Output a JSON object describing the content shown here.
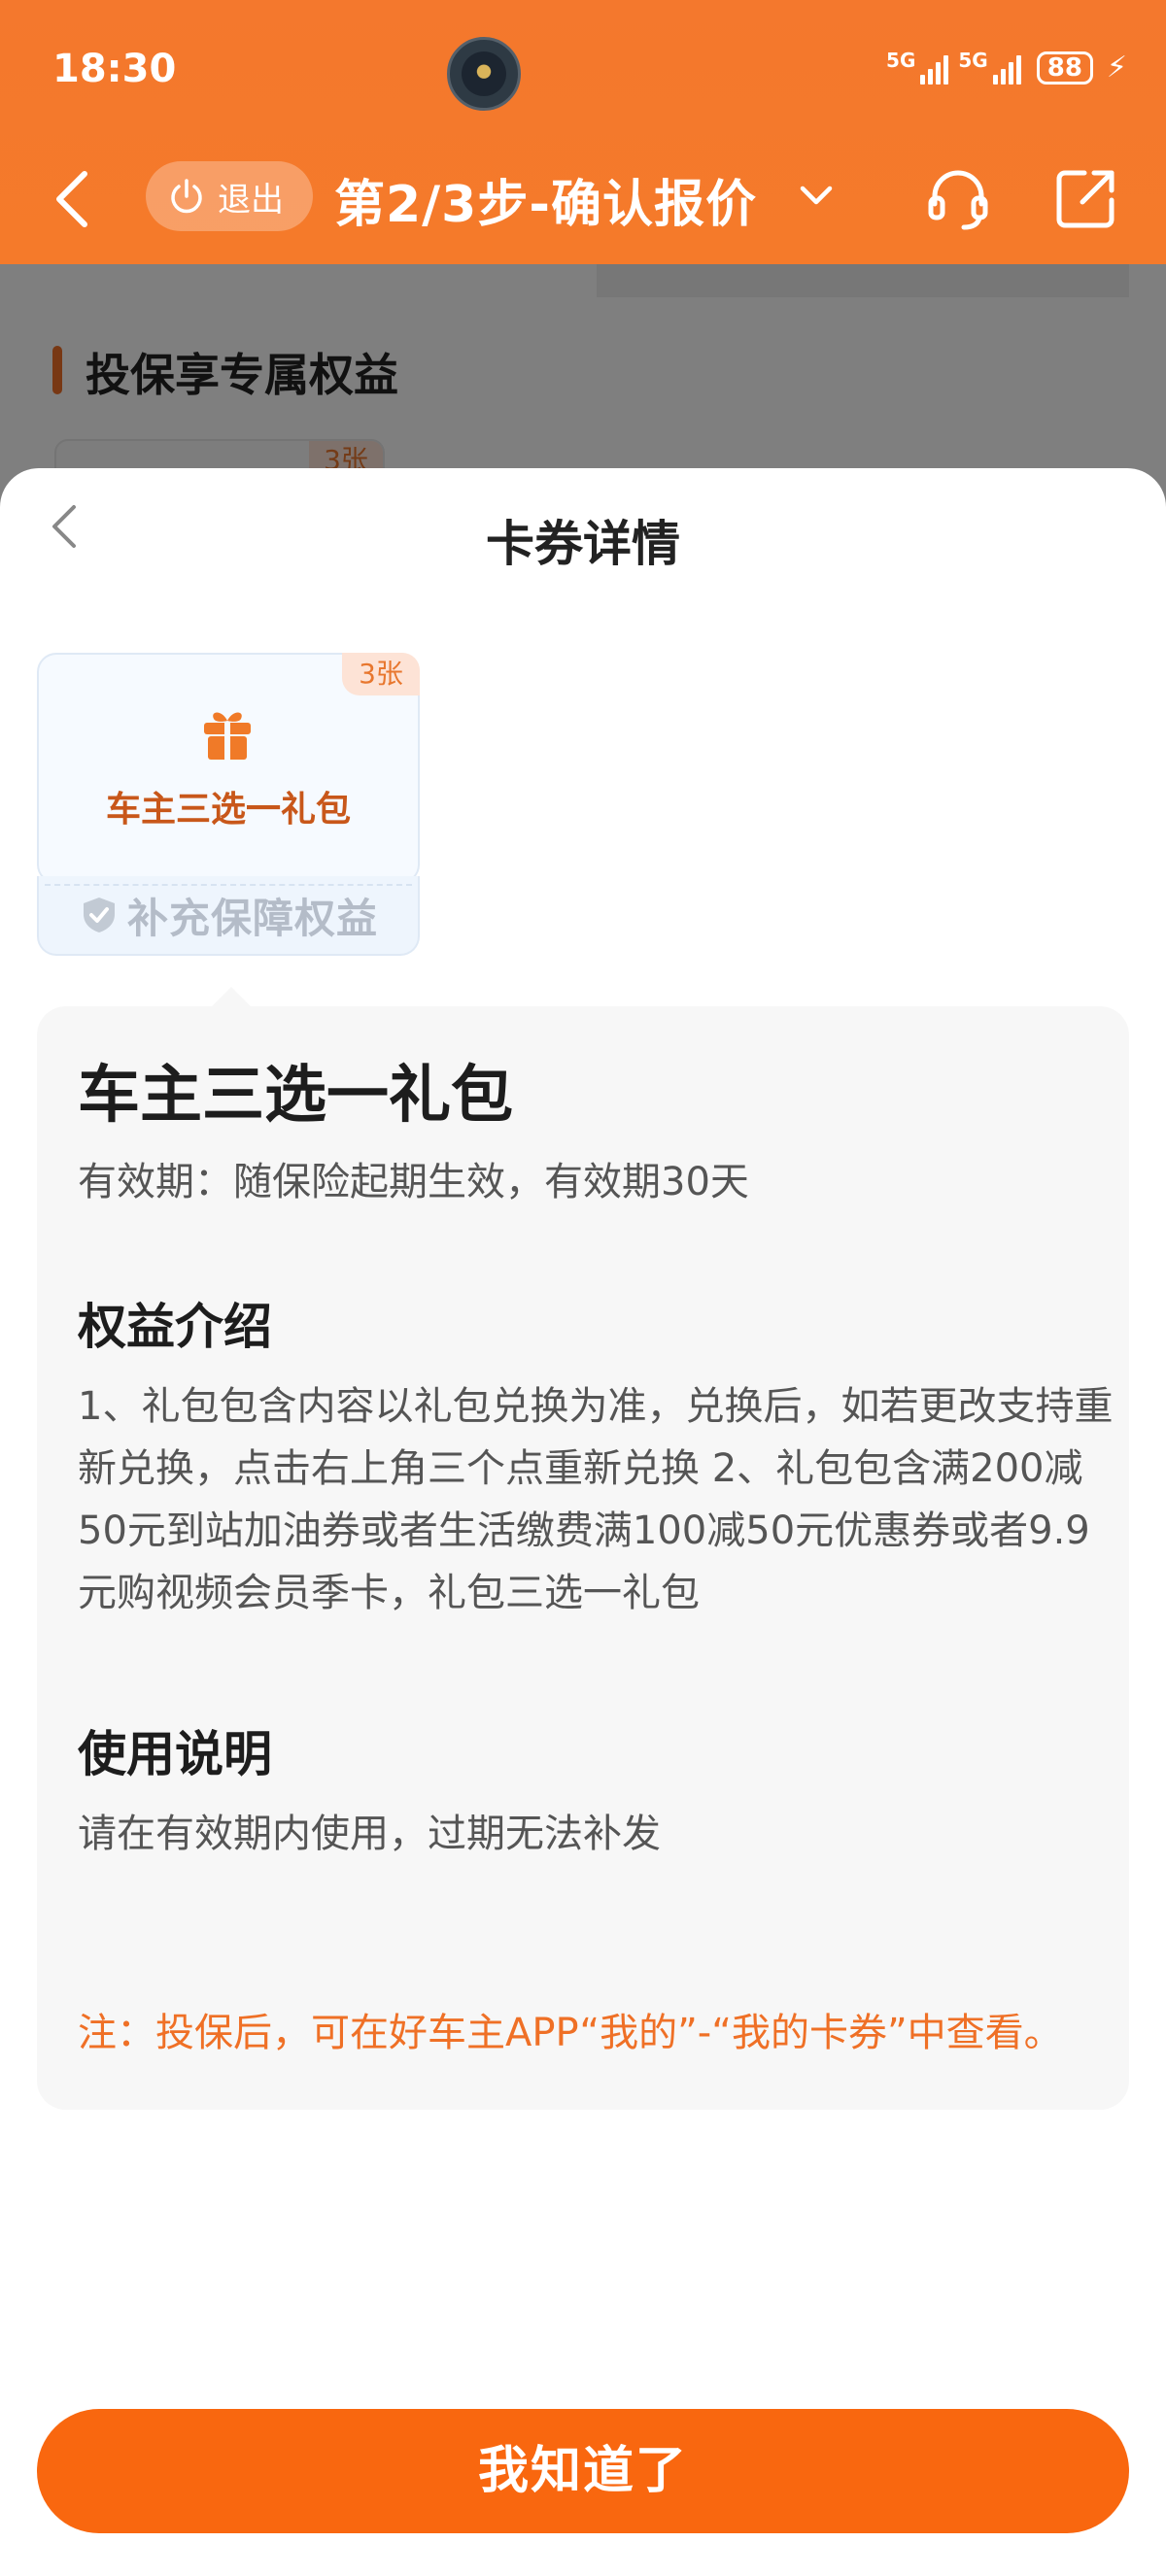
{
  "status_bar": {
    "time": "18:30",
    "network_1": "5G",
    "network_2": "5G",
    "battery": "88"
  },
  "header": {
    "exit_label": "退出",
    "title": "第2/3步-确认报价"
  },
  "background": {
    "section_title": "投保享专属权益",
    "coupon_count": "3张"
  },
  "sheet": {
    "title": "卡券详情",
    "coupon": {
      "count": "3张",
      "name": "车主三选一礼包",
      "footer": "补充保障权益"
    },
    "detail": {
      "title": "车主三选一礼包",
      "validity": "有效期：随保险起期生效，有效期30天",
      "benefits_heading": "权益介绍",
      "benefits_text": "1、礼包包含内容以礼包兑换为准，兑换后，如若更改支持重新兑换，点击右上角三个点重新兑换 2、礼包包含满200减50元到站加油券或者生活缴费满100减50元优惠券或者9.9元购视频会员季卡，礼包三选一礼包",
      "usage_heading": "使用说明",
      "usage_text": "请在有效期内使用，过期无法补发",
      "note": "注：投保后，可在好车主APP“我的”-“我的卡券”中查看。"
    },
    "confirm_button": "我知道了"
  },
  "colors": {
    "header_orange": "#f57a2a",
    "accent_orange": "#f9670f",
    "note_orange": "#ef7026",
    "coupon_text": "#c8571a"
  },
  "icons": [
    "back-arrow-icon",
    "power-icon",
    "chevron-down-icon",
    "headset-icon",
    "share-icon",
    "gift-icon",
    "shield-check-icon"
  ]
}
